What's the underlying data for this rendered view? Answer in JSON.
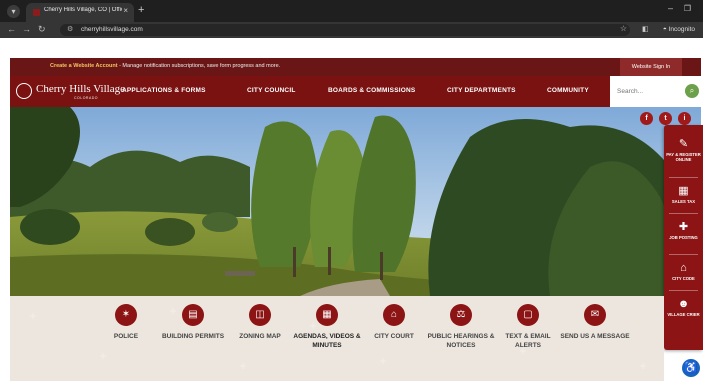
{
  "browser": {
    "tab_title": "Cherry Hills Village, CO | Officia",
    "tab_close": "×",
    "new_tab": "+",
    "url": "cherryhillsvillage.com",
    "profile_label": "Incognito",
    "icons": [
      "back-icon",
      "forward-icon",
      "reload-icon",
      "site-info-icon",
      "bookmark-star-icon",
      "side-panel-icon",
      "incognito-icon"
    ]
  },
  "promo": {
    "link_text": "Create a Website Account",
    "text": " - Manage notification subscriptions, save form progress and more.",
    "signin_label": "Website Sign In",
    "link_color": "#f4c463"
  },
  "header": {
    "logo_name": "Cherry Hills Village",
    "logo_sub": "COLORADO",
    "nav": [
      "APPLICATIONS & FORMS",
      "CITY COUNCIL",
      "BOARDS & COMMISSIONS",
      "CITY DEPARTMENTS",
      "COMMUNITY"
    ],
    "search_placeholder": "Search...",
    "brand_color": "#7a1212"
  },
  "social": [
    "f",
    "t",
    "i"
  ],
  "rail": [
    {
      "label": "PAY & REGISTER ONLINE",
      "icon": "pay-register-icon"
    },
    {
      "label": "SALES TAX",
      "icon": "calculator-icon"
    },
    {
      "label": "JOB POSTING",
      "icon": "add-user-icon"
    },
    {
      "label": "CITY CODE",
      "icon": "building-icon"
    },
    {
      "label": "VILLAGE CRIER",
      "icon": "people-icon"
    }
  ],
  "quick_links": [
    {
      "label": "POLICE",
      "icon": "badge-star-icon"
    },
    {
      "label": "BUILDING PERMITS",
      "icon": "document-icon"
    },
    {
      "label": "ZONING MAP",
      "icon": "map-icon"
    },
    {
      "label": "AGENDAS, VIDEOS & MINUTES",
      "icon": "agenda-icon"
    },
    {
      "label": "CITY COURT",
      "icon": "courthouse-icon"
    },
    {
      "label": "PUBLIC HEARINGS & NOTICES",
      "icon": "gavel-icon"
    },
    {
      "label": "TEXT & EMAIL ALERTS",
      "icon": "phone-icon"
    },
    {
      "label": "SEND US A MESSAGE",
      "icon": "envelope-icon"
    }
  ]
}
